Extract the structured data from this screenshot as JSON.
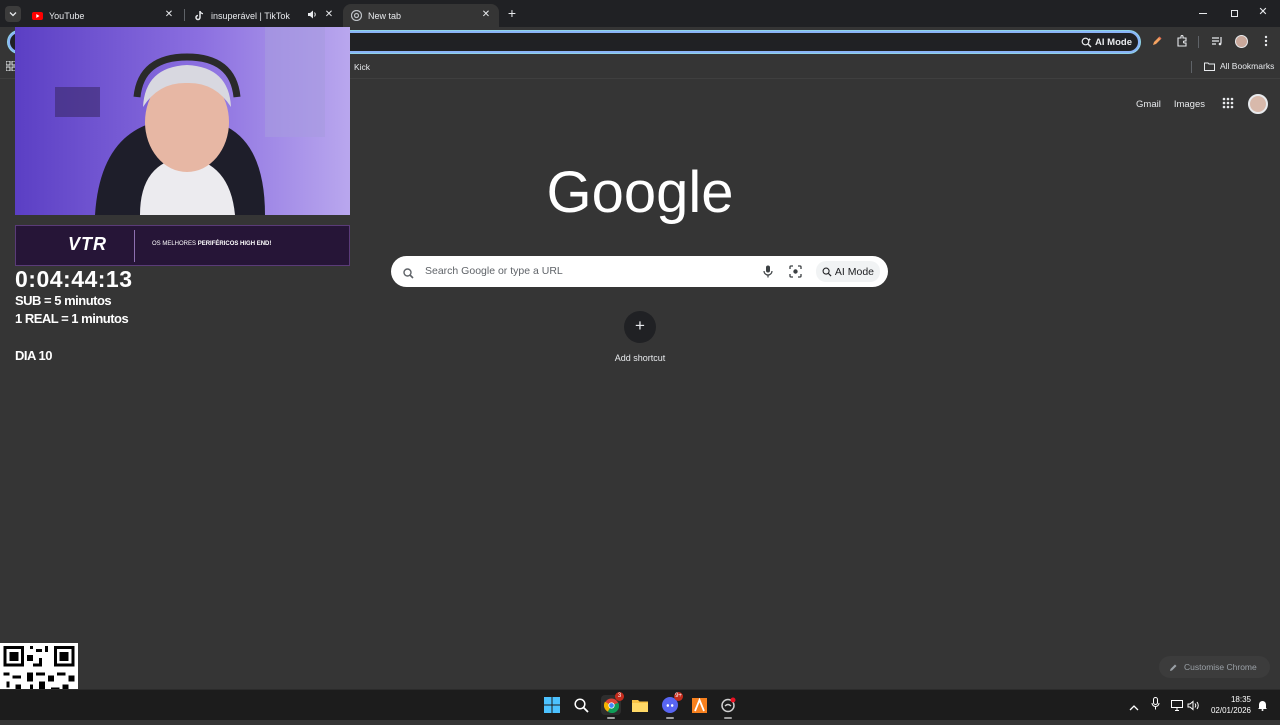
{
  "tabs": [
    {
      "label": "YouTube",
      "icon": "youtube-icon"
    },
    {
      "label": "insuperável | TikTok",
      "icon": "tiktok-icon",
      "audio": true
    },
    {
      "label": "New tab",
      "icon": "chrome-icon",
      "active": true
    }
  ],
  "omnibox": {
    "ai_mode_label": "AI Mode",
    "value": ""
  },
  "bookmarks": {
    "items": [
      "Kick"
    ],
    "all_bookmarks_label": "All Bookmarks"
  },
  "ntp": {
    "gmail_label": "Gmail",
    "images_label": "Images",
    "logo_text": "Google",
    "search_placeholder": "Search Google or type a URL",
    "ai_mode_label": "AI Mode",
    "add_shortcut_label": "Add shortcut",
    "customise_label": "Customise Chrome"
  },
  "stream_overlay": {
    "timer": "0:04:44:13",
    "line1": "SUB = 5 minutos",
    "line2": "1 REAL =  1 minutos",
    "day": "DIA 10",
    "banner_brand": "VTR",
    "banner_text_plain": "OS MELHORES",
    "banner_text_bold": "PERIFÉRICOS HIGH END!"
  },
  "taskbar": {
    "time": "18:35",
    "date": "02/01/2026",
    "badges": {
      "chrome": "3",
      "discord": "9+"
    }
  },
  "colors": {
    "page_bg": "#353535",
    "tabstrip_bg": "#202124",
    "omnibox_focus": "#8ab4f8",
    "taskbar_bg": "#1c1c1c"
  }
}
